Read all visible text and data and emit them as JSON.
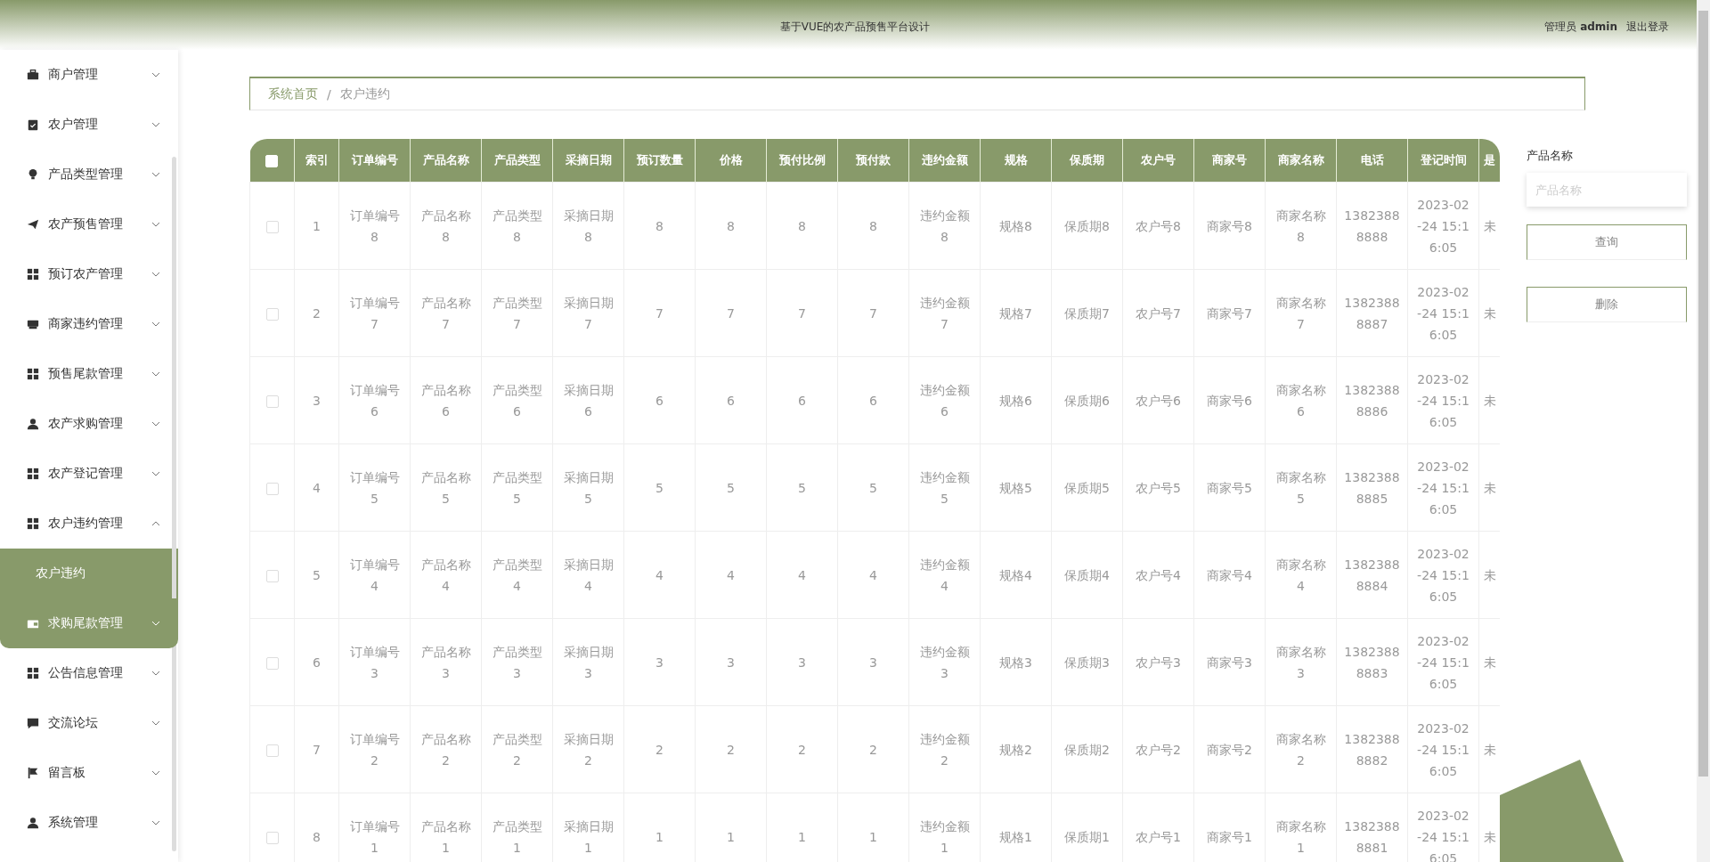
{
  "header": {
    "title": "基于VUE的农产品预售平台设计",
    "user_label": "管理员",
    "user_name": "admin",
    "logout": "退出登录"
  },
  "sidebar": {
    "items": [
      {
        "label": "商户管理",
        "expanded": false,
        "highlighted": false
      },
      {
        "label": "农户管理",
        "expanded": false,
        "highlighted": false
      },
      {
        "label": "产品类型管理",
        "expanded": false,
        "highlighted": false
      },
      {
        "label": "农产预售管理",
        "expanded": false,
        "highlighted": false
      },
      {
        "label": "预订农产管理",
        "expanded": false,
        "highlighted": false
      },
      {
        "label": "商家违约管理",
        "expanded": false,
        "highlighted": false
      },
      {
        "label": "预售尾款管理",
        "expanded": false,
        "highlighted": false
      },
      {
        "label": "农产求购管理",
        "expanded": false,
        "highlighted": false
      },
      {
        "label": "农产登记管理",
        "expanded": false,
        "highlighted": false
      },
      {
        "label": "农户违约管理",
        "expanded": true,
        "highlighted": false,
        "children": [
          {
            "label": "农户违约",
            "selected": true
          }
        ]
      },
      {
        "label": "求购尾款管理",
        "expanded": false,
        "highlighted": true
      },
      {
        "label": "公告信息管理",
        "expanded": false,
        "highlighted": false
      },
      {
        "label": "交流论坛",
        "expanded": false,
        "highlighted": false
      },
      {
        "label": "留言板",
        "expanded": false,
        "highlighted": false
      },
      {
        "label": "系统管理",
        "expanded": false,
        "highlighted": false
      }
    ]
  },
  "breadcrumb": {
    "separator": "/",
    "items": [
      {
        "label": "系统首页"
      },
      {
        "label": "农户违约"
      }
    ]
  },
  "table": {
    "select_all_checked": false,
    "columns": [
      "索引",
      "订单编号",
      "产品名称",
      "产品类型",
      "采摘日期",
      "预订数量",
      "价格",
      "预付比例",
      "预付款",
      "违约金额",
      "规格",
      "保质期",
      "农户号",
      "商家号",
      "商家名称",
      "电话",
      "登记时间",
      "是"
    ],
    "rows": [
      {
        "checked": false,
        "cells": [
          "1",
          "订单编号8",
          "产品名称8",
          "产品类型8",
          "采摘日期8",
          "8",
          "8",
          "8",
          "8",
          "违约金额8",
          "规格8",
          "保质期8",
          "农户号8",
          "商家号8",
          "商家名称8",
          "13823888888",
          "2023-02-24 15:16:05",
          "未"
        ]
      },
      {
        "checked": false,
        "cells": [
          "2",
          "订单编号7",
          "产品名称7",
          "产品类型7",
          "采摘日期7",
          "7",
          "7",
          "7",
          "7",
          "违约金额7",
          "规格7",
          "保质期7",
          "农户号7",
          "商家号7",
          "商家名称7",
          "13823888887",
          "2023-02-24 15:16:05",
          "未"
        ]
      },
      {
        "checked": false,
        "cells": [
          "3",
          "订单编号6",
          "产品名称6",
          "产品类型6",
          "采摘日期6",
          "6",
          "6",
          "6",
          "6",
          "违约金额6",
          "规格6",
          "保质期6",
          "农户号6",
          "商家号6",
          "商家名称6",
          "13823888886",
          "2023-02-24 15:16:05",
          "未"
        ]
      },
      {
        "checked": false,
        "cells": [
          "4",
          "订单编号5",
          "产品名称5",
          "产品类型5",
          "采摘日期5",
          "5",
          "5",
          "5",
          "5",
          "违约金额5",
          "规格5",
          "保质期5",
          "农户号5",
          "商家号5",
          "商家名称5",
          "13823888885",
          "2023-02-24 15:16:05",
          "未"
        ]
      },
      {
        "checked": false,
        "cells": [
          "5",
          "订单编号4",
          "产品名称4",
          "产品类型4",
          "采摘日期4",
          "4",
          "4",
          "4",
          "4",
          "违约金额4",
          "规格4",
          "保质期4",
          "农户号4",
          "商家号4",
          "商家名称4",
          "13823888884",
          "2023-02-24 15:16:05",
          "未"
        ]
      },
      {
        "checked": false,
        "cells": [
          "6",
          "订单编号3",
          "产品名称3",
          "产品类型3",
          "采摘日期3",
          "3",
          "3",
          "3",
          "3",
          "违约金额3",
          "规格3",
          "保质期3",
          "农户号3",
          "商家号3",
          "商家名称3",
          "13823888883",
          "2023-02-24 15:16:05",
          "未"
        ]
      },
      {
        "checked": false,
        "cells": [
          "7",
          "订单编号2",
          "产品名称2",
          "产品类型2",
          "采摘日期2",
          "2",
          "2",
          "2",
          "2",
          "违约金额2",
          "规格2",
          "保质期2",
          "农户号2",
          "商家号2",
          "商家名称2",
          "13823888882",
          "2023-02-24 15:16:05",
          "未"
        ]
      },
      {
        "checked": false,
        "cells": [
          "8",
          "订单编号1",
          "产品名称1",
          "产品类型1",
          "采摘日期1",
          "1",
          "1",
          "1",
          "1",
          "违约金额1",
          "规格1",
          "保质期1",
          "农户号1",
          "商家号1",
          "商家名称1",
          "13823888881",
          "2023-02-24 15:16:05",
          "未"
        ]
      }
    ]
  },
  "search": {
    "label": "产品名称",
    "placeholder": "产品名称",
    "buttons": [
      {
        "label": "查询"
      },
      {
        "label": "删除"
      }
    ]
  }
}
